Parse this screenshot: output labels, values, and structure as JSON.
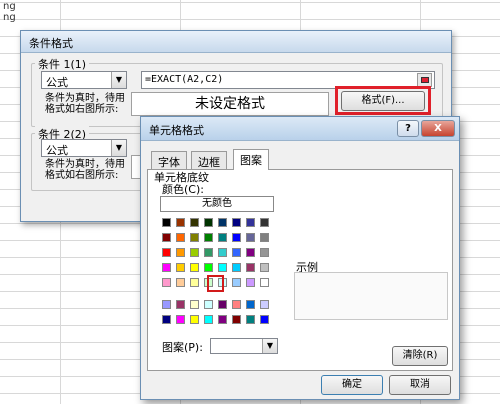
{
  "background": {
    "cell_text": [
      "ng",
      "ng"
    ]
  },
  "cf_dialog": {
    "title": "条件格式",
    "condition1": {
      "label": "条件 1(1)",
      "type": "公式",
      "formula": "=EXACT(A2,C2)",
      "hint_line1": "条件为真时，待用",
      "hint_line2": "格式如右图所示:",
      "preview": "未设定格式",
      "format_button": "格式(F)..."
    },
    "condition2": {
      "label": "条件 2(2)",
      "type": "公式",
      "hint_line1": "条件为真时，待用",
      "hint_line2": "格式如右图所示:"
    }
  },
  "fc_dialog": {
    "title": "单元格格式",
    "help_button": "?",
    "close_button": "X",
    "tabs": [
      "字体",
      "边框",
      "图案"
    ],
    "active_tab": "图案",
    "shading_label": "单元格底纹",
    "color_label": "颜色(C):",
    "no_color_button": "无颜色",
    "sample_label": "示例",
    "pattern_label": "图案(P):",
    "clear_button": "清除(R)",
    "ok_button": "确定",
    "cancel_button": "取消",
    "selected_color": "#00FF00",
    "palette_main": [
      [
        "#000000",
        "#993300",
        "#333300",
        "#003300",
        "#003366",
        "#000080",
        "#333399",
        "#333333"
      ],
      [
        "#800000",
        "#FF6600",
        "#808000",
        "#008000",
        "#008080",
        "#0000FF",
        "#666699",
        "#808080"
      ],
      [
        "#FF0000",
        "#FF9900",
        "#99CC00",
        "#339966",
        "#33CCCC",
        "#3366FF",
        "#800080",
        "#969696"
      ],
      [
        "#FF00FF",
        "#FFCC00",
        "#FFFF00",
        "#00FF00",
        "#00FFFF",
        "#00CCFF",
        "#993366",
        "#C0C0C0"
      ],
      [
        "#FF99CC",
        "#FFCC99",
        "#FFFF99",
        "#CCFFCC",
        "#CCFFFF",
        "#99CCFF",
        "#CC99FF",
        "#FFFFFF"
      ]
    ],
    "palette_extra": [
      [
        "#9999FF",
        "#993366",
        "#FFFFCC",
        "#CCFFFF",
        "#660066",
        "#FF8080",
        "#0066CC",
        "#CCCCFF"
      ],
      [
        "#000080",
        "#FF00FF",
        "#FFFF00",
        "#00FFFF",
        "#800080",
        "#800000",
        "#008080",
        "#0000FF"
      ]
    ]
  }
}
